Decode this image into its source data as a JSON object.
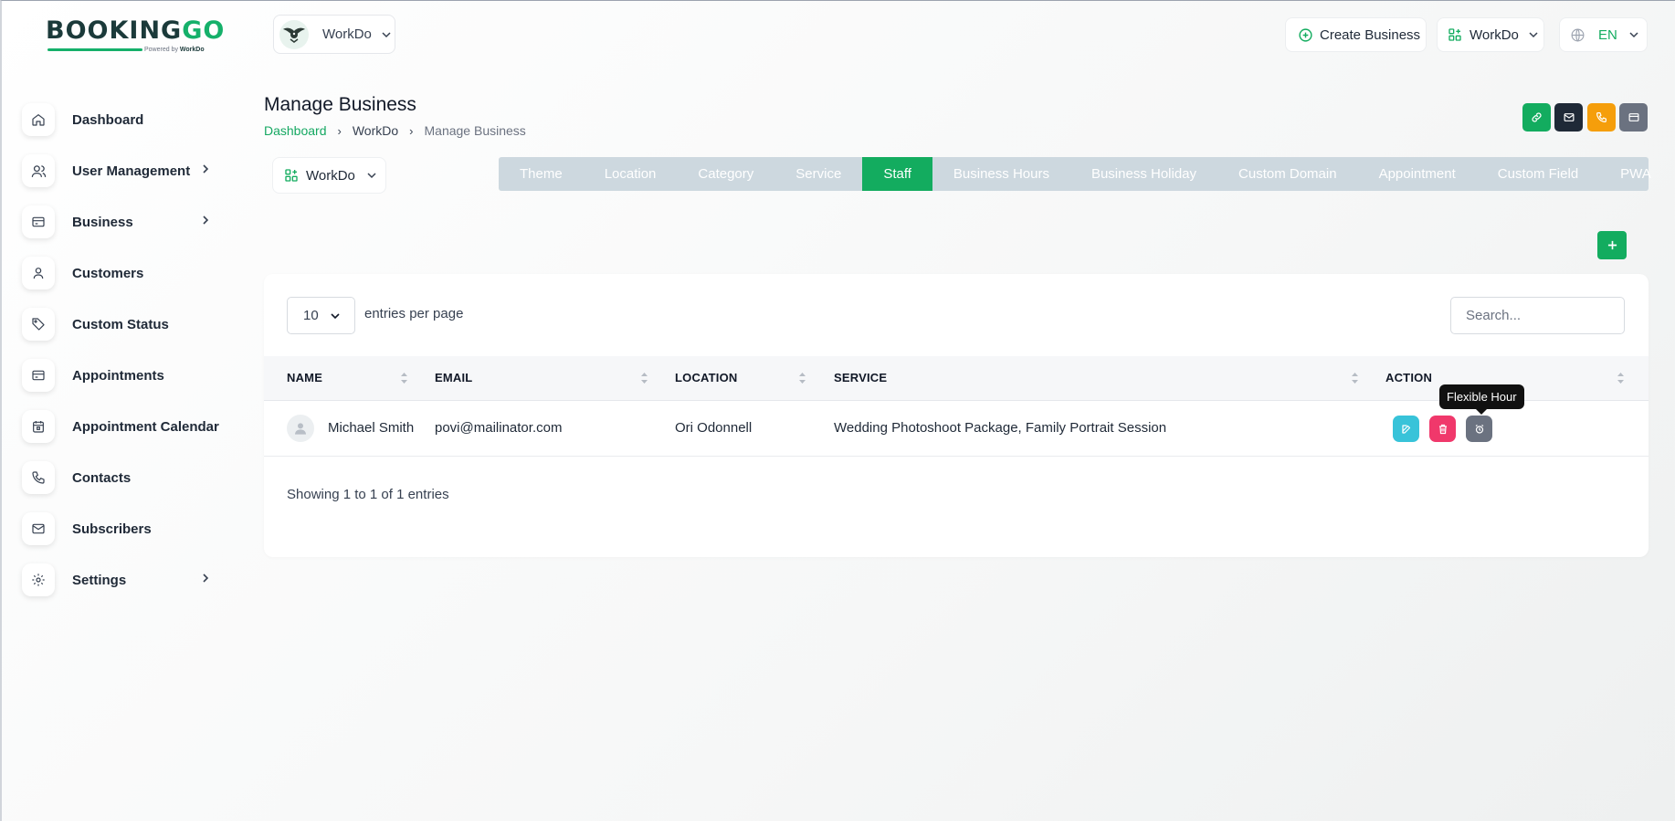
{
  "logo": {
    "brand_main": "BOOKING",
    "brand_accent": "GO",
    "powered_prefix": "Powered by",
    "powered_brand": "WorkDo"
  },
  "sidebar": {
    "items": [
      {
        "label": "Dashboard",
        "icon": "home-icon",
        "has_submenu": false
      },
      {
        "label": "User Management",
        "icon": "users-icon",
        "has_submenu": true
      },
      {
        "label": "Business",
        "icon": "business-card-icon",
        "has_submenu": true
      },
      {
        "label": "Customers",
        "icon": "user-icon",
        "has_submenu": false
      },
      {
        "label": "Custom Status",
        "icon": "tag-icon",
        "has_submenu": false
      },
      {
        "label": "Appointments",
        "icon": "calendar-card-icon",
        "has_submenu": false
      },
      {
        "label": "Appointment Calendar",
        "icon": "calendar-icon",
        "has_submenu": false
      },
      {
        "label": "Contacts",
        "icon": "phone-icon",
        "has_submenu": false
      },
      {
        "label": "Subscribers",
        "icon": "mail-icon",
        "has_submenu": false
      },
      {
        "label": "Settings",
        "icon": "gear-icon",
        "has_submenu": true
      }
    ]
  },
  "topbar": {
    "business_name": "WorkDo",
    "create_business_label": "Create Business",
    "workspace_label": "WorkDo",
    "language_label": "EN"
  },
  "page": {
    "title": "Manage Business",
    "breadcrumb": [
      "Dashboard",
      "WorkDo",
      "Manage Business"
    ]
  },
  "header_buttons": [
    {
      "name": "copy-link-button",
      "icon": "link-icon",
      "color": "#13ac5f"
    },
    {
      "name": "email-button",
      "icon": "mail-icon",
      "color": "#1f2937"
    },
    {
      "name": "call-button",
      "icon": "phone-icon",
      "color": "#f59e0b"
    },
    {
      "name": "card-button",
      "icon": "card-icon",
      "color": "#6b7280"
    }
  ],
  "business_selector": {
    "value": "WorkDo"
  },
  "tabs": [
    "Theme",
    "Location",
    "Category",
    "Service",
    "Staff",
    "Business Hours",
    "Business Holiday",
    "Custom Domain",
    "Appointment",
    "Custom Field",
    "PWA"
  ],
  "active_tab": "Staff",
  "table": {
    "per_page_value": "10",
    "per_page_label": "entries per page",
    "search_placeholder": "Search...",
    "columns": [
      "NAME",
      "EMAIL",
      "LOCATION",
      "SERVICE",
      "ACTION"
    ],
    "rows": [
      {
        "name": "Michael Smith",
        "email": "povi@mailinator.com",
        "location": "Ori Odonnell",
        "service": "Wedding Photoshoot Package, Family Portrait Session"
      }
    ],
    "footer": "Showing 1 to 1 of 1 entries"
  },
  "tooltip": {
    "text": "Flexible Hour"
  },
  "colors": {
    "accent": "#13ac5f",
    "edit": "#38c3d9",
    "delete": "#f0386b",
    "flexible_hour": "#6b7280",
    "tabs_bg": "#cdd8df"
  }
}
